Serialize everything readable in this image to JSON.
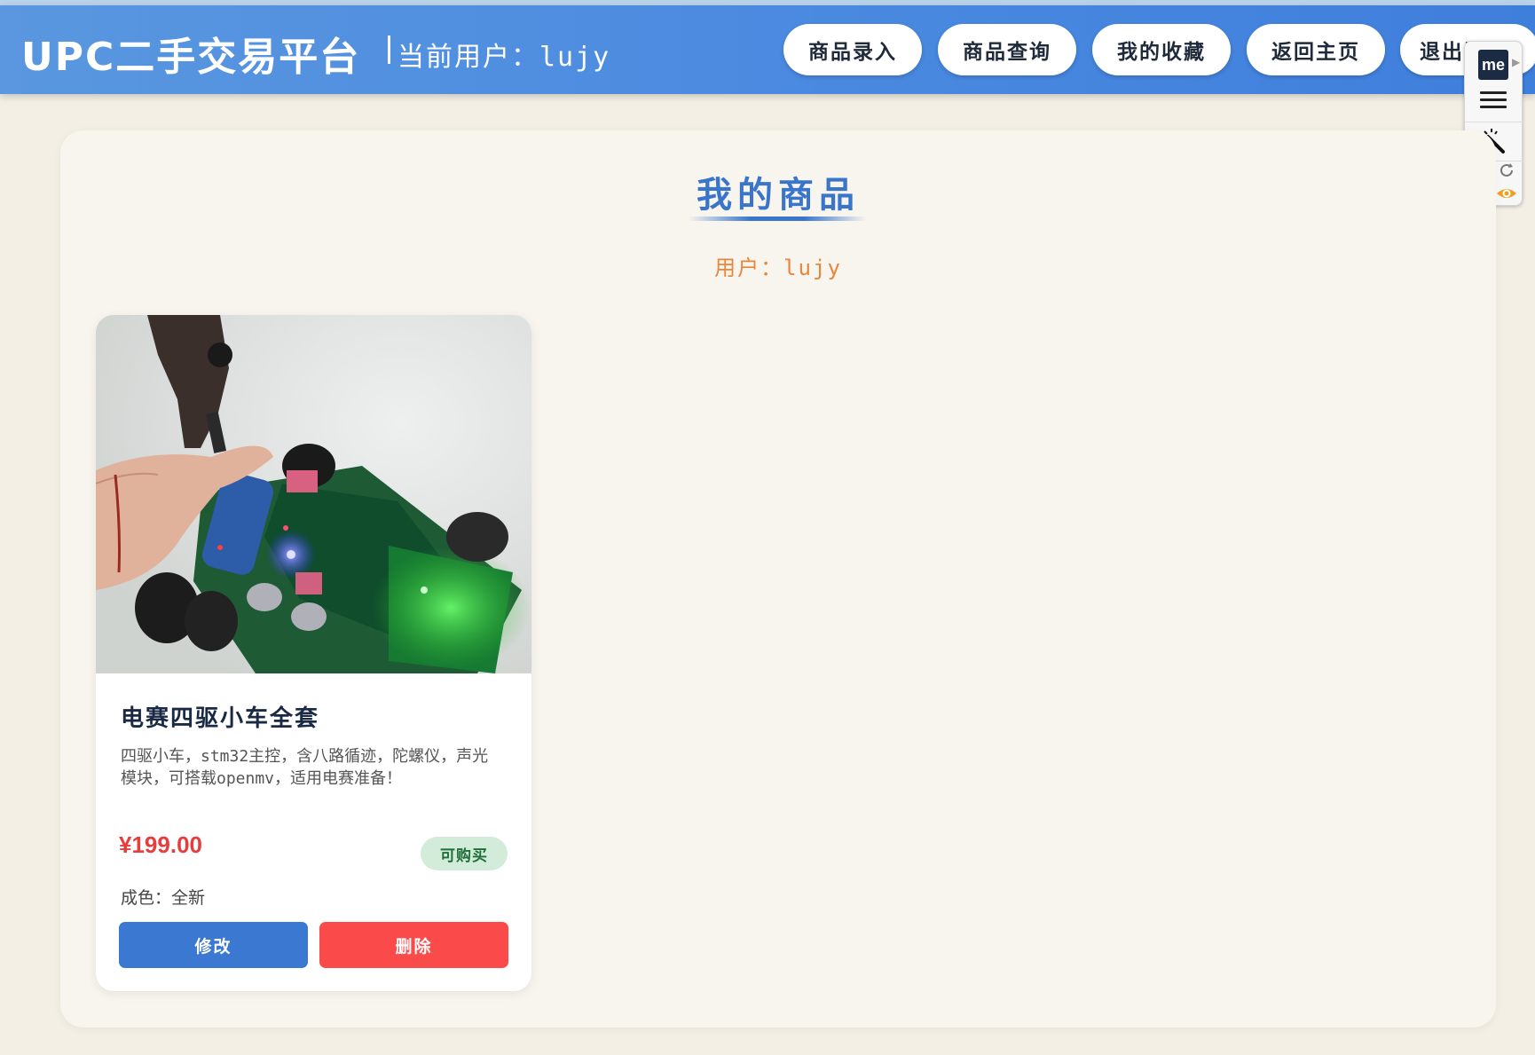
{
  "header": {
    "brand": "UPC二手交易平台",
    "current_user": "当前用户：lujy",
    "nav": {
      "add_product": "商品录入",
      "search_product": "商品查询",
      "favorites": "我的收藏",
      "home": "返回主页",
      "logout": "退出登"
    }
  },
  "extension": {
    "logo_text": "me"
  },
  "main": {
    "title": "我的商品",
    "user_line": "用户：lujy"
  },
  "product": {
    "name": "电赛四驱小车全套",
    "description": "四驱小车，stm32主控，含八路循迹，陀螺仪，声光模块，可搭载openmv，适用电赛准备！",
    "price": "¥199.00",
    "status": "可购买",
    "condition": "成色：全新",
    "edit_label": "修改",
    "delete_label": "删除"
  },
  "colors": {
    "header_blue": "#4b8ae0",
    "title_blue": "#3a75cc",
    "user_orange": "#e8863a",
    "price_red": "#e53e3e",
    "edit_blue": "#3a78d2",
    "delete_red": "#fb4a4a",
    "badge_green_bg": "#d2ecd9",
    "page_bg": "#f3efe4"
  }
}
